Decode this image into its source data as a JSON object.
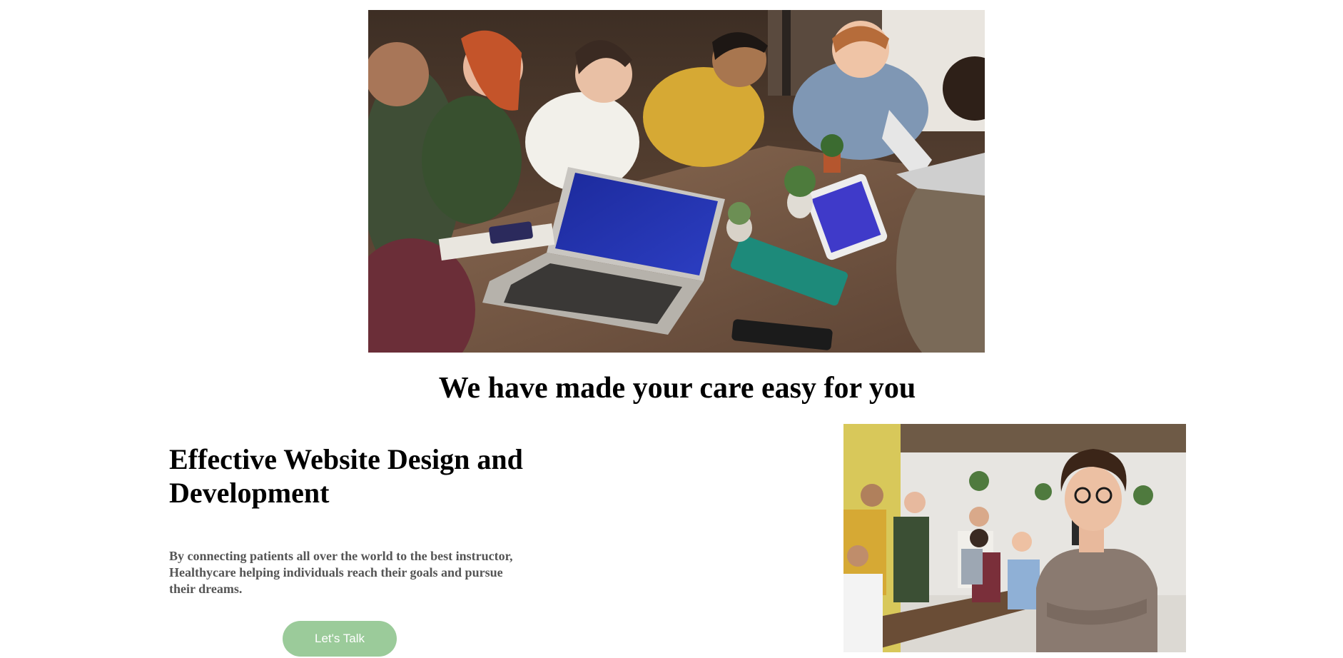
{
  "hero": {
    "image_alt": "team-meeting-photo"
  },
  "section": {
    "heading": "We have made your care easy for you"
  },
  "feature": {
    "title": "Effective Website Design and Development",
    "description": "By connecting patients all over the world to the best instructor, Healthycare helping individuals reach their goals and pursue their dreams.",
    "cta_label": "Let's Talk",
    "image_alt": "business-woman-photo"
  },
  "colors": {
    "cta_background": "#9bcb9a",
    "cta_text": "#ffffff",
    "description_text": "#555555"
  }
}
